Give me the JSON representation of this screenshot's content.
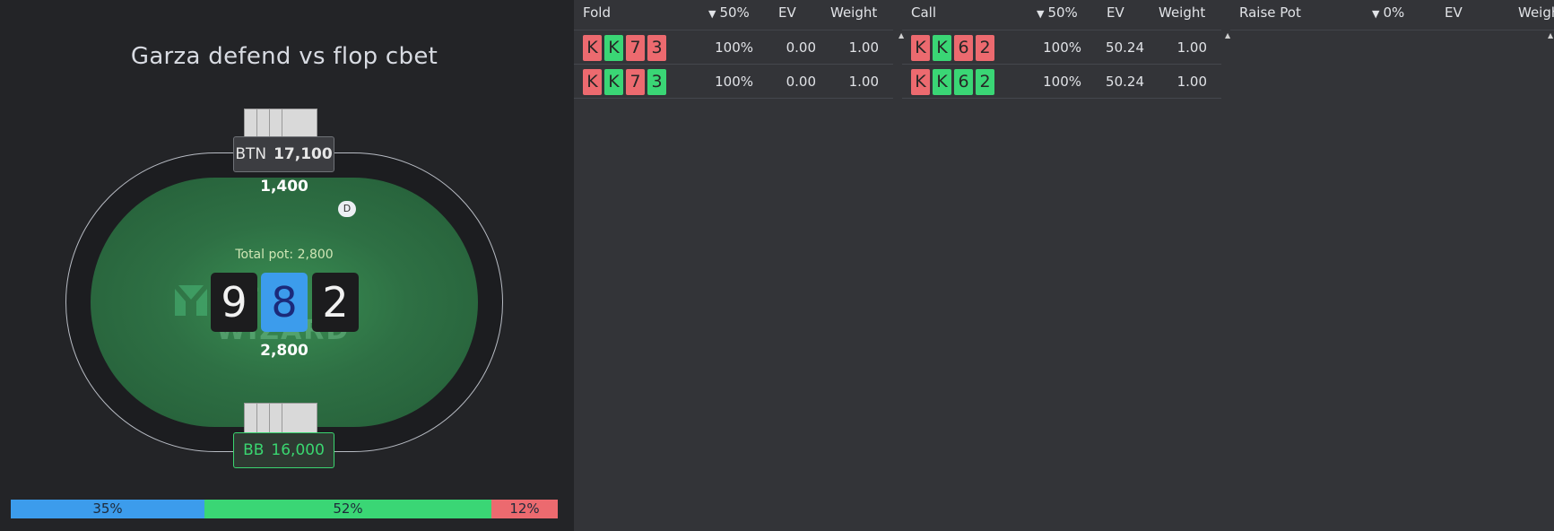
{
  "table": {
    "title": "Garza defend vs flop cbet",
    "total_pot": "Total pot: 2,800",
    "pot_center": "2,800",
    "dealer_label": "D",
    "watermark": "GTO WIZARD",
    "board": [
      "9",
      "8",
      "2"
    ],
    "btn": {
      "position": "BTN",
      "stack": "17,100",
      "bet": "1,400"
    },
    "bb": {
      "position": "BB",
      "stack": "16,000"
    }
  },
  "frequencies": [
    {
      "label": "35%",
      "value": 35,
      "color": "#3c9cec"
    },
    {
      "label": "52%",
      "value": 52,
      "color": "#3ad675"
    },
    {
      "label": "12%",
      "value": 12,
      "color": "#ec6a6f"
    }
  ],
  "columns": [
    {
      "action": "Fold",
      "freq": "50%",
      "ev_header": "EV",
      "weight_header": "Weight",
      "rows": [
        {
          "cards": [
            "K",
            "K",
            "7",
            "3"
          ],
          "suits": [
            "r",
            "g",
            "r",
            "r"
          ],
          "pct": "100%",
          "ev": "0.00",
          "weight": "1.00"
        },
        {
          "cards": [
            "K",
            "K",
            "7",
            "3"
          ],
          "suits": [
            "r",
            "g",
            "r",
            "g"
          ],
          "pct": "100%",
          "ev": "0.00",
          "weight": "1.00"
        }
      ]
    },
    {
      "action": "Call",
      "freq": "50%",
      "ev_header": "EV",
      "weight_header": "Weight",
      "rows": [
        {
          "cards": [
            "K",
            "K",
            "6",
            "2"
          ],
          "suits": [
            "r",
            "g",
            "r",
            "r"
          ],
          "pct": "100%",
          "ev": "50.24",
          "weight": "1.00"
        },
        {
          "cards": [
            "K",
            "K",
            "6",
            "2"
          ],
          "suits": [
            "r",
            "g",
            "g",
            "g"
          ],
          "pct": "100%",
          "ev": "50.24",
          "weight": "1.00"
        }
      ]
    },
    {
      "action": "Raise Pot",
      "freq": "0%",
      "ev_header": "EV",
      "weight_header": "Weight",
      "rows": []
    }
  ]
}
